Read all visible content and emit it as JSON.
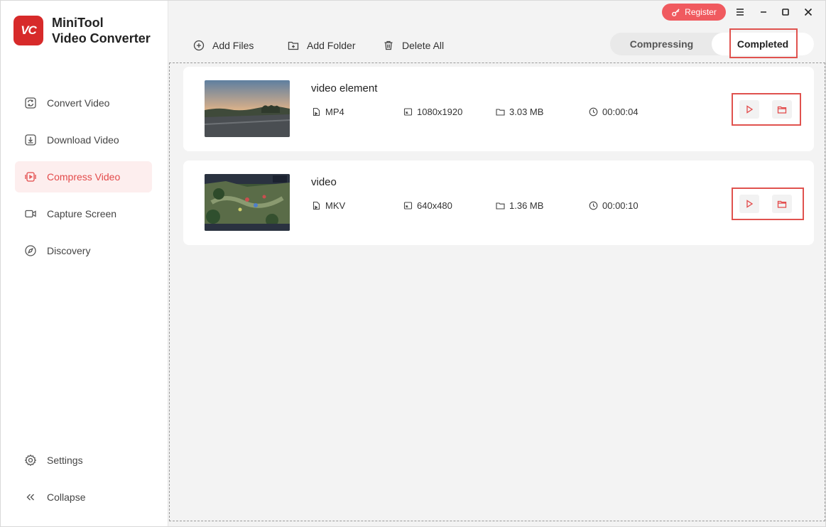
{
  "app": {
    "name_line1": "MiniTool",
    "name_line2": "Video Converter",
    "logo_text": "VC",
    "accent_color": "#e34a4a"
  },
  "sidebar": {
    "items": [
      {
        "label": "Convert Video",
        "icon": "convert-icon",
        "active": false
      },
      {
        "label": "Download Video",
        "icon": "download-icon",
        "active": false
      },
      {
        "label": "Compress Video",
        "icon": "compress-icon",
        "active": true
      },
      {
        "label": "Capture Screen",
        "icon": "camera-icon",
        "active": false
      },
      {
        "label": "Discovery",
        "icon": "compass-icon",
        "active": false
      }
    ],
    "bottom": [
      {
        "label": "Settings",
        "icon": "gear-icon"
      },
      {
        "label": "Collapse",
        "icon": "double-chevron-left-icon"
      }
    ]
  },
  "titlebar": {
    "register_label": "Register"
  },
  "toolbar": {
    "add_files": "Add Files",
    "add_folder": "Add Folder",
    "delete_all": "Delete All"
  },
  "tabs": {
    "compressing": "Compressing",
    "completed": "Completed",
    "selected": "completed"
  },
  "files": [
    {
      "name": "video element",
      "format": "MP4",
      "resolution": "1080x1920",
      "size": "3.03 MB",
      "duration": "00:00:04"
    },
    {
      "name": "video",
      "format": "MKV",
      "resolution": "640x480",
      "size": "1.36 MB",
      "duration": "00:00:10"
    }
  ]
}
